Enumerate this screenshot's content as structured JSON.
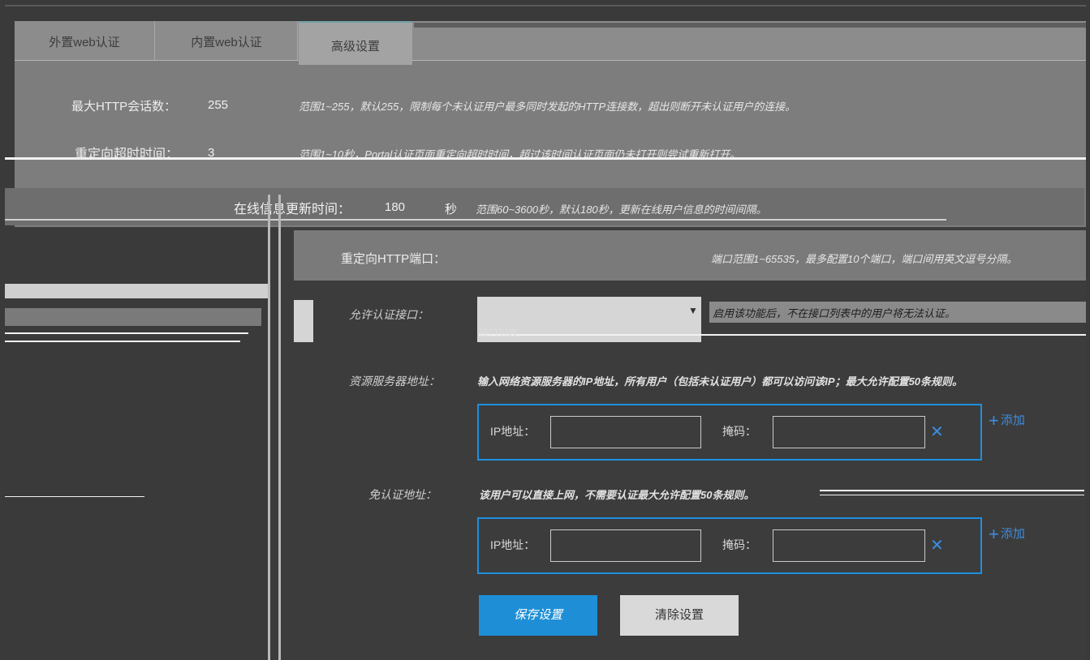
{
  "tabs": [
    {
      "label": "外置web认证"
    },
    {
      "label": "内置web认证"
    },
    {
      "label": "高级设置",
      "active": true
    }
  ],
  "settings": {
    "max_http_sessions": {
      "label": "最大HTTP会话数：",
      "value": "255",
      "hint": "范围1~255，默认255，限制每个未认证用户最多同时发起的HTTP连接数，超出则断开未认证用户的连接。"
    },
    "redirect_timeout": {
      "label": "重定向超时时间：",
      "value": "3",
      "hint": "范围1~10秒，Portal认证页面重定向超时时间，超过该时间认证页面仍未打开则尝试重新打开。"
    },
    "online_info_update": {
      "label": "在线信息更新时间：",
      "value": "180",
      "unit": "秒",
      "hint": "范围60~3600秒，默认180秒，更新在线用户信息的时间间隔。"
    },
    "redirect_http_port": {
      "label": "重定向HTTP端口：",
      "hint": "端口范围1~65535，最多配置10个端口，端口间用英文逗号分隔。"
    },
    "allowed_interface": {
      "label": "允许认证接口：",
      "hint": "启用该功能后，不在接口列表中的用户将无法认证。",
      "hint2": "接口列表"
    },
    "resource_server": {
      "label": "资源服务器地址：",
      "hint": "输入网络资源服务器的IP地址，所有用户（包括未认证用户）都可以访问该IP；最大允许配置50条规则。"
    },
    "free_auth_address": {
      "label": "免认证地址：",
      "hint": "该用户可以直接上网，不需要认证最大允许配置50条规则。"
    }
  },
  "rule_form": {
    "ip_label": "IP地址：",
    "mask_label": "掩码：",
    "ip_value": "",
    "mask_value": "",
    "add_label": "添加"
  },
  "buttons": {
    "save": "保存设置",
    "clear": "清除设置"
  },
  "colors": {
    "accent": "#1e8fe0",
    "panel": "#7d7d7d",
    "background": "#3a3a3a"
  }
}
